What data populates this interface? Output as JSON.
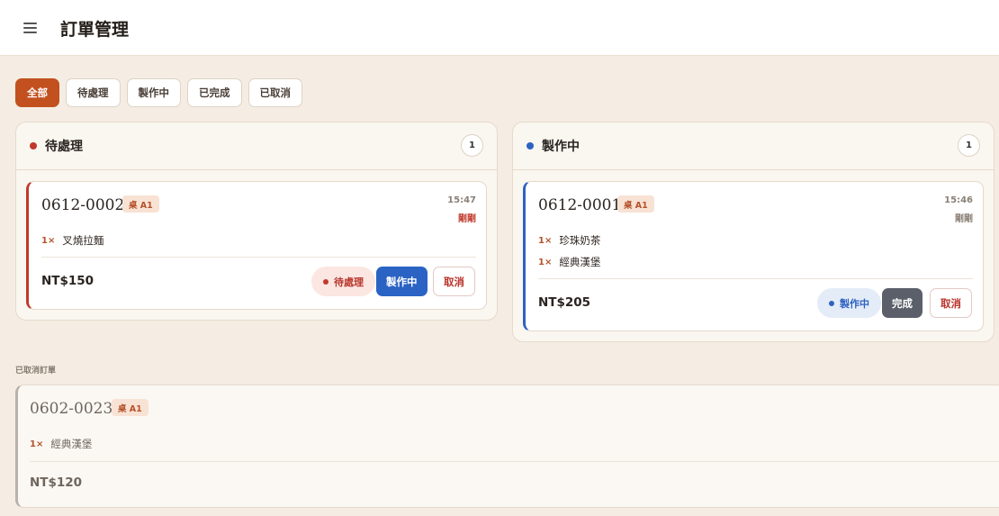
{
  "header": {
    "title": "訂單管理",
    "menu_icon": "menu-icon"
  },
  "filters": [
    "全部",
    "待處理",
    "製作中",
    "已完成",
    "已取消"
  ],
  "columns": [
    {
      "title": "待處理",
      "count": "1",
      "color": "#c0392b",
      "orders": [
        {
          "order_no": "0612-0002",
          "table": "桌 A1",
          "time": "15:47",
          "ago": "剛剛",
          "items": [
            {
              "qty": "1×",
              "name": "叉燒拉麵"
            }
          ],
          "total": "NT$150",
          "status": "待處理",
          "primary_action": "製作中",
          "cancel": "取消"
        }
      ]
    },
    {
      "title": "製作中",
      "count": "1",
      "color": "#2e62c0",
      "orders": [
        {
          "order_no": "0612-0001",
          "table": "桌 A1",
          "time": "15:46",
          "ago": "剛剛",
          "items": [
            {
              "qty": "1×",
              "name": "珍珠奶茶"
            },
            {
              "qty": "1×",
              "name": "經典漢堡"
            }
          ],
          "total": "NT$205",
          "status": "製作中",
          "primary_action": "完成",
          "cancel": "取消"
        }
      ]
    }
  ],
  "cancelled": {
    "label": "已取消訂單",
    "orders": [
      {
        "order_no": "0602-0023",
        "table": "桌 A1",
        "items": [
          {
            "qty": "1×",
            "name": "經典漢堡"
          }
        ],
        "total": "NT$120"
      }
    ]
  },
  "colors": {
    "accent": "#c2511f",
    "pending": "#c0392b",
    "making": "#2e62c0",
    "done_btn": "#5a5f6a"
  }
}
